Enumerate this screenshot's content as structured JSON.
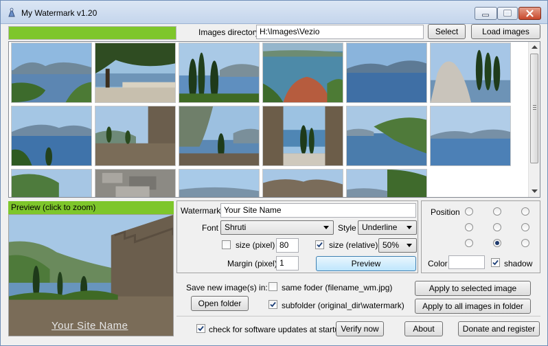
{
  "window": {
    "title": "My Watermark v1.20"
  },
  "top_bar": {
    "progress_fraction": 1.0,
    "images_directory_label": "Images directory",
    "images_directory_value": "H:\\Images\\Vezio",
    "select_label": "Select",
    "load_images_label": "Load images"
  },
  "preview": {
    "header": "Preview (click to zoom)",
    "watermark_overlay": "Your Site Name"
  },
  "watermark": {
    "label": "Watermark",
    "value": "Your Site Name",
    "font_label": "Font",
    "font_value": "Shruti",
    "style_label": "Style",
    "style_value": "Underline",
    "size_pixel_label": "size (pixel)",
    "size_pixel_checked": false,
    "size_pixel_value": "80",
    "size_relative_label": "size (relative)",
    "size_relative_checked": true,
    "size_relative_value": "50%",
    "margin_label": "Margin (pixel)",
    "margin_value": "1",
    "preview_button": "Preview"
  },
  "position": {
    "label": "Position",
    "selected_row": 2,
    "selected_col": 1,
    "color_label": "Color",
    "color_value": "#ffffff",
    "shadow_label": "shadow",
    "shadow_checked": true
  },
  "save": {
    "label": "Save new image(s) in:",
    "same_folder_label": "same foder (filename_wm.jpg)",
    "same_folder_checked": false,
    "subfolder_label": "subfolder (original_dir\\watermark)",
    "subfolder_checked": true,
    "open_folder_label": "Open folder",
    "apply_selected_label": "Apply to selected image",
    "apply_all_label": "Apply to all images in folder"
  },
  "footer": {
    "check_updates_label": "check for software updates at startup",
    "check_updates_checked": true,
    "verify_label": "Verify now",
    "about_label": "About",
    "donate_label": "Donate and register"
  },
  "colors": {
    "progress_green": "#7ec62b",
    "title_gradient": "#c4d5ec"
  },
  "icons": {
    "app": "watermark-app-icon",
    "minimize": "minimize-icon",
    "maximize": "maximize-icon",
    "close": "close-icon"
  }
}
